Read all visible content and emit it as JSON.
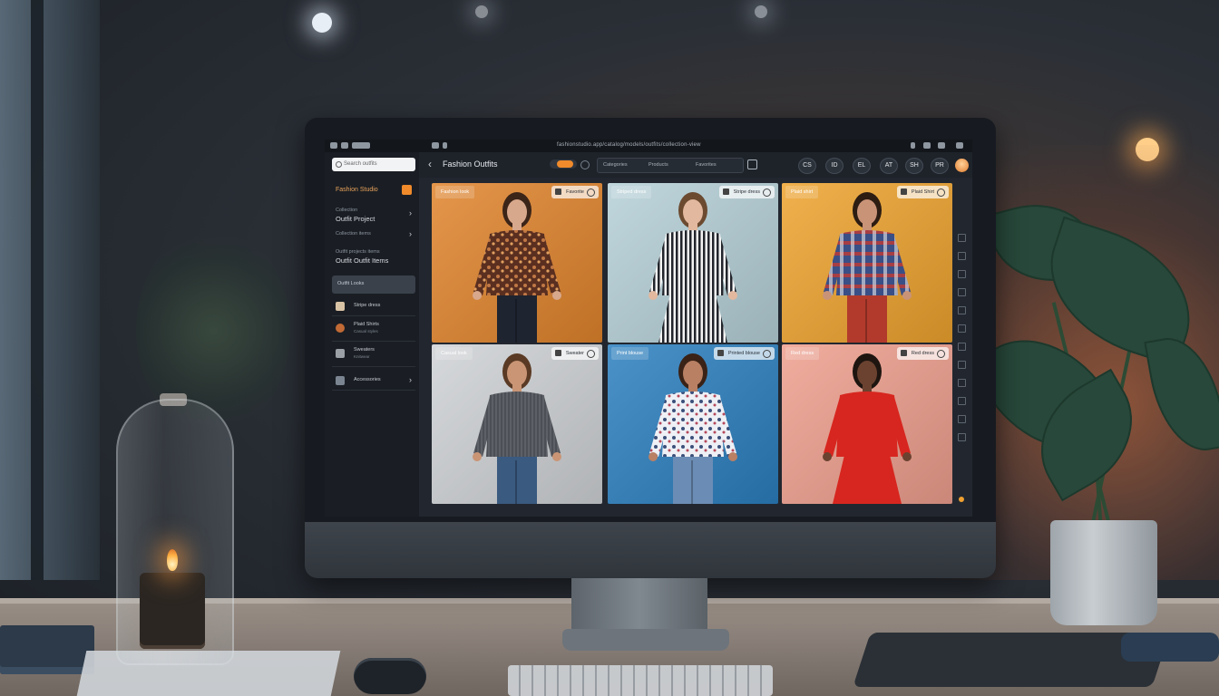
{
  "browser": {
    "url_text": "fashionstudio.app/catalog/models/outfits/collection-view"
  },
  "sidebar": {
    "search_placeholder": "Search outfits",
    "brand_label": "Fashion Studio",
    "groups": [
      {
        "small": "Collection",
        "big": "Outfit Project"
      },
      {
        "small": "Collection items"
      }
    ],
    "section_small": "Outfit projects items",
    "section_big": "Outfit Outfit Items",
    "items": [
      {
        "text": "Outfit Looks",
        "sub": "",
        "active": true,
        "thumb": "#8a6a4a"
      },
      {
        "text": "Stripe dress",
        "sub": "",
        "active": false,
        "thumb": "#d9c3a5"
      },
      {
        "text": "Plaid Shirts",
        "sub": "Casual styles",
        "active": false,
        "thumb": "#c26a35"
      },
      {
        "text": "Sweaters",
        "sub": "Knitwear",
        "active": false,
        "thumb": "#9aa0a6"
      },
      {
        "text": "Accessories",
        "sub": "",
        "active": false,
        "thumb": "#7b8591"
      }
    ]
  },
  "toolbar": {
    "title": "Fashion Outfits",
    "filters": [
      "Categories",
      "Products",
      "Favorites"
    ],
    "tools": [
      "CS",
      "ID",
      "EL",
      "AT",
      "SH",
      "PR"
    ]
  },
  "cards": [
    {
      "tag": "Fashion look",
      "chip": "Favorite",
      "bg": "#e0842c",
      "top": "#6b3a26",
      "pattern": "floral",
      "bottom": "#1e2430",
      "skin": "#d8a88c",
      "hair": "#3b2418"
    },
    {
      "tag": "Striped dress",
      "chip": "Stripe dress",
      "bg": "#b5d0d7",
      "top": "#2a2d33",
      "pattern": "stripes",
      "bottom": "#2a2d33",
      "skin": "#e2b89e",
      "hair": "#6b4a30"
    },
    {
      "tag": "Plaid shirt",
      "chip": "Plaid Shirt",
      "bg": "#eea32e",
      "top": "#3a4f86",
      "pattern": "plaid",
      "bottom": "#b23a2c",
      "skin": "#c99378",
      "hair": "#2c1c12"
    },
    {
      "tag": "Casual look",
      "chip": "Sweater",
      "bg": "#cfd2d5",
      "top": "#5d6066",
      "pattern": "knit",
      "bottom": "#3a5a80",
      "skin": "#c99575",
      "hair": "#5a3a24"
    },
    {
      "tag": "Print blouse",
      "chip": "Printed blouse",
      "bg": "#2b7fbf",
      "top": "#eef0f5",
      "pattern": "floral-light",
      "bottom": "#6b8db5",
      "skin": "#b98064",
      "hair": "#3a2216"
    },
    {
      "tag": "Red dress",
      "chip": "Red dress",
      "bg": "#ee9f8e",
      "top": "#d7261f",
      "pattern": "solid",
      "bottom": "#d7261f",
      "skin": "#6b4230",
      "hair": "#1e1510"
    }
  ],
  "colors": {
    "accent": "#f08a2b",
    "screen_bg": "#1c2027",
    "sidebar_bg": "#1a1e24"
  }
}
